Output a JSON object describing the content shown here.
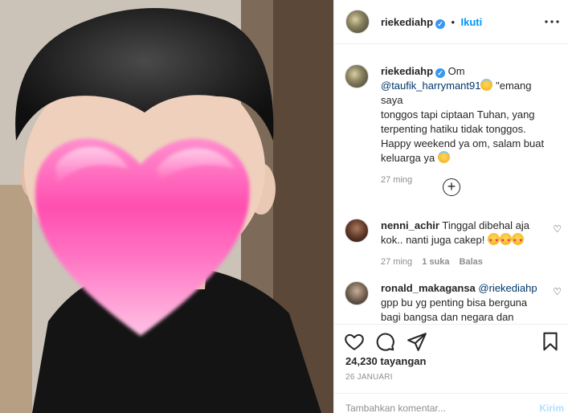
{
  "post": {
    "author": "riekediahp",
    "dot": "•",
    "follow_label": "Ikuti",
    "verified_mark": "✓"
  },
  "caption": {
    "username": "riekediahp",
    "lead": "Om",
    "mention": "@taufik_harrymant91",
    "text_1": "\"emang saya",
    "text_2": "tonggos tapi ciptaan Tuhan, yang",
    "text_3": "terpenting hatiku tidak tonggos.",
    "text_4": "Happy weekend ya om, salam buat",
    "text_5": "keluarga ya",
    "time": "27 ming"
  },
  "load_more_icon": "+",
  "comments": [
    {
      "username": "nenni_achir",
      "text_1": "Tinggal dibehal aja",
      "text_2": "kok.. nanti juga cakep!",
      "time": "27 ming",
      "likes": "1 suka",
      "reply": "Balas",
      "like_icon": "♡"
    },
    {
      "username": "ronald_makagansa",
      "mention": "@riekediahp",
      "text_1": "gpp bu yg penting bisa berguna",
      "text_2": "bagi bangsa dan negara dan",
      "like_icon": "♡"
    }
  ],
  "stats": {
    "views": "24,230 tayangan",
    "date": "26 JANUARI"
  },
  "composer": {
    "placeholder": "Tambahkan komentar...",
    "send_label": "Kirim"
  },
  "icons": {
    "more": "more-icon",
    "like": "heart-icon",
    "comment": "comment-icon",
    "share": "share-icon",
    "save": "bookmark-icon",
    "heart_sticker": "heart-sticker"
  },
  "colors": {
    "link": "#0095f6",
    "verified": "#3897f0",
    "heart_sticker": "#ff5fb4",
    "muted": "#8e8e8e"
  }
}
